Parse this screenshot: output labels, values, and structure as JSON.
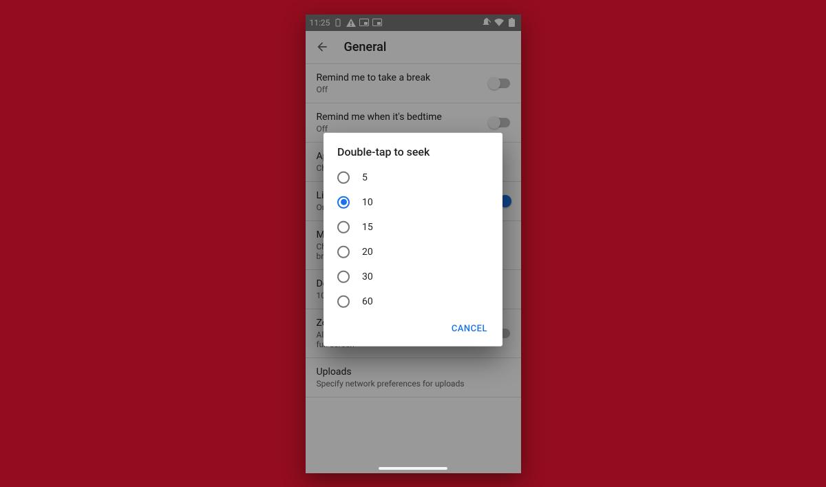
{
  "status": {
    "time": "11:25"
  },
  "header": {
    "title": "General"
  },
  "settings": {
    "break": {
      "title": "Remind me to take a break",
      "sub": "Off",
      "on": false
    },
    "bedtime": {
      "title": "Remind me when it's bedtime",
      "sub": "Off",
      "on": false
    },
    "appearance": {
      "title": "Appearance",
      "sub": "Choose your light or dark theme"
    },
    "mobile": {
      "title": "Limit mobile data usage",
      "sub": "Only stream HD on Wi-Fi",
      "on": true
    },
    "muted": {
      "title": "Muted playback in feeds",
      "sub": "Choose whether videos play with sound while browsing"
    },
    "seek": {
      "title": "Double-tap to seek",
      "sub": "10 seconds"
    },
    "zoom": {
      "title": "Zoom to fill screen",
      "sub": "Always zoom so that videos fill the screen in full screen",
      "on": false
    },
    "uploads": {
      "title": "Uploads",
      "sub": "Specify network preferences for uploads"
    }
  },
  "dialog": {
    "title": "Double-tap to seek",
    "selected": "10",
    "options": [
      "5",
      "10",
      "15",
      "20",
      "30",
      "60"
    ],
    "cancel": "CANCEL"
  }
}
